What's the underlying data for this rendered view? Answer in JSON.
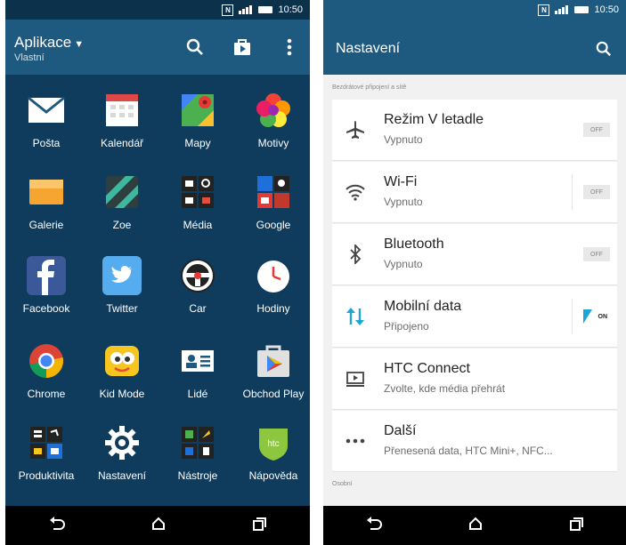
{
  "left": {
    "status": {
      "time": "10:50",
      "nfc": "N"
    },
    "header": {
      "title": "Aplikace",
      "subtitle": "Vlastní"
    },
    "apps": [
      {
        "label": "Pošta",
        "icon": "mail-icon"
      },
      {
        "label": "Kalendář",
        "icon": "calendar-icon"
      },
      {
        "label": "Mapy",
        "icon": "maps-icon"
      },
      {
        "label": "Motivy",
        "icon": "themes-icon"
      },
      {
        "label": "Galerie",
        "icon": "gallery-icon"
      },
      {
        "label": "Zoe",
        "icon": "zoe-icon"
      },
      {
        "label": "Média",
        "icon": "media-icon"
      },
      {
        "label": "Google",
        "icon": "google-folder-icon"
      },
      {
        "label": "Facebook",
        "icon": "facebook-icon"
      },
      {
        "label": "Twitter",
        "icon": "twitter-icon"
      },
      {
        "label": "Car",
        "icon": "car-icon"
      },
      {
        "label": "Hodiny",
        "icon": "clock-icon"
      },
      {
        "label": "Chrome",
        "icon": "chrome-icon"
      },
      {
        "label": "Kid Mode",
        "icon": "kid-mode-icon"
      },
      {
        "label": "Lidé",
        "icon": "people-icon"
      },
      {
        "label": "Obchod Play",
        "icon": "play-store-icon"
      },
      {
        "label": "Produktivita",
        "icon": "productivity-folder-icon"
      },
      {
        "label": "Nastavení",
        "icon": "settings-gear-icon"
      },
      {
        "label": "Nástroje",
        "icon": "tools-folder-icon"
      },
      {
        "label": "Nápověda",
        "icon": "help-icon"
      }
    ]
  },
  "right": {
    "status": {
      "time": "10:50",
      "nfc": "N"
    },
    "header": {
      "title": "Nastavení"
    },
    "section_wireless": "Bezdrátové připojení a sítě",
    "section_personal": "Osobní",
    "rows": [
      {
        "title": "Režim V letadle",
        "subtitle": "Vypnuto",
        "toggle": "OFF",
        "icon": "airplane-icon"
      },
      {
        "title": "Wi-Fi",
        "subtitle": "Vypnuto",
        "toggle": "OFF",
        "icon": "wifi-icon"
      },
      {
        "title": "Bluetooth",
        "subtitle": "Vypnuto",
        "toggle": "OFF",
        "icon": "bluetooth-icon"
      },
      {
        "title": "Mobilní data",
        "subtitle": "Připojeno",
        "toggle": "ON",
        "icon": "mobile-data-icon"
      },
      {
        "title": "HTC Connect",
        "subtitle": "Zvolte, kde média přehrát",
        "toggle": "",
        "icon": "htc-connect-icon"
      },
      {
        "title": "Další",
        "subtitle": "Přenesená data, HTC Mini+, NFC...",
        "toggle": "",
        "icon": "more-icon"
      }
    ]
  }
}
